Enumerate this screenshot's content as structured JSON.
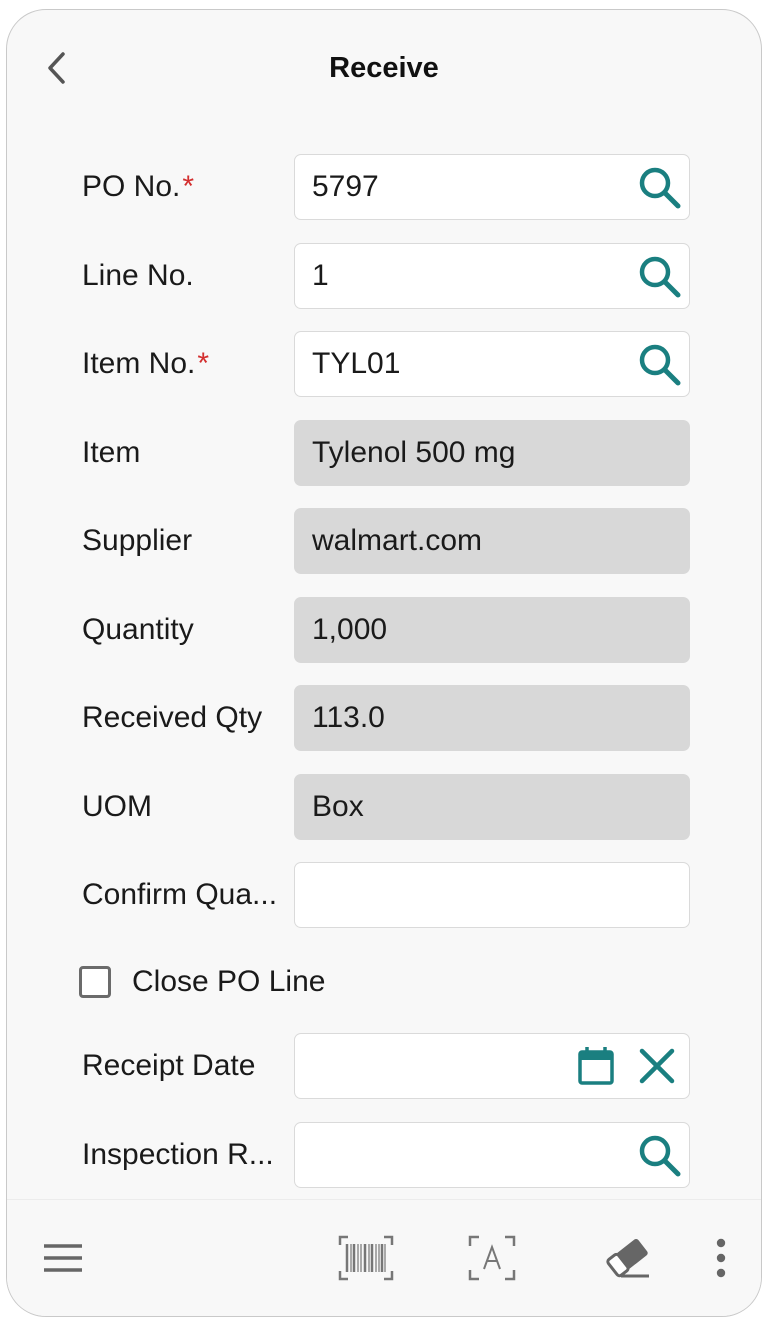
{
  "header": {
    "title": "Receive"
  },
  "form": {
    "po_no": {
      "label": "PO No.",
      "required_mark": "*",
      "value": "5797"
    },
    "line_no": {
      "label": "Line No.",
      "value": "1"
    },
    "item_no": {
      "label": "Item No.",
      "required_mark": "*",
      "value": "TYL01"
    },
    "item": {
      "label": "Item",
      "value": "Tylenol 500 mg"
    },
    "supplier": {
      "label": "Supplier",
      "value": "walmart.com"
    },
    "quantity": {
      "label": "Quantity",
      "value": "1,000"
    },
    "received_qty": {
      "label": "Received Qty",
      "value": "113.0"
    },
    "uom": {
      "label": "UOM",
      "value": "Box"
    },
    "confirm_quantity": {
      "label": "Confirm Qua...",
      "value": ""
    },
    "close_po_line": {
      "label": "Close PO Line",
      "checked": false
    },
    "receipt_date": {
      "label": "Receipt Date",
      "value": ""
    },
    "inspection": {
      "label": "Inspection R...",
      "value": ""
    }
  },
  "colors": {
    "accent": "#1a7f80",
    "required": "#d32f2f",
    "readonly_bg": "#d8d8d8",
    "icon_gray": "#666666"
  },
  "icons": [
    "back-arrow",
    "search",
    "calendar",
    "clear-x",
    "menu",
    "barcode-scan",
    "text-scan",
    "eraser",
    "more-vertical"
  ]
}
